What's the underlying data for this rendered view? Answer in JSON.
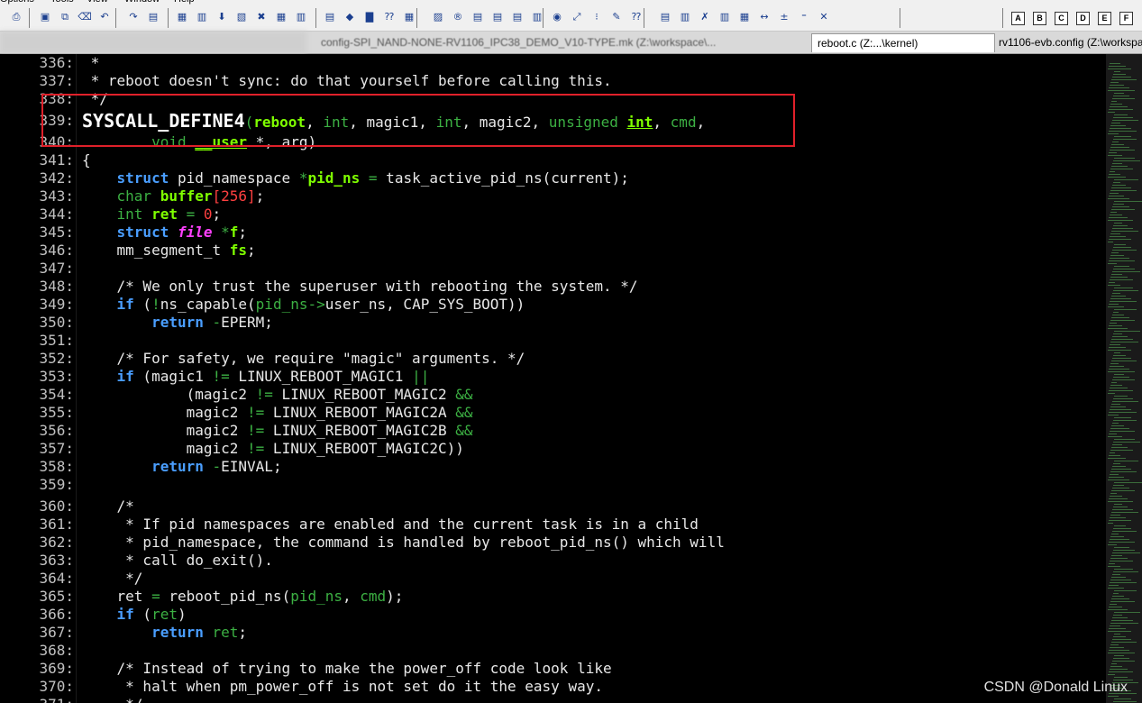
{
  "menu": [
    "Options",
    "Tools",
    "View",
    "Window",
    "Help"
  ],
  "toolbar_letters": [
    "A",
    "B",
    "C",
    "D",
    "E",
    "F"
  ],
  "tabs": [
    {
      "label": "config-SPI_NAND-NONE-RV1106_IPC38_DEMO_V10-TYPE.mk (Z:\\workspace\\...",
      "active": false
    },
    {
      "label": "reboot.c (Z:...\\kernel)",
      "active": true
    },
    {
      "label": "rv1106-evb.config (Z:\\workspa",
      "active": false
    }
  ],
  "editor": {
    "lines": [
      {
        "n": "336:",
        "t": [
          [
            "cm",
            " *"
          ]
        ]
      },
      {
        "n": "337:",
        "t": [
          [
            "cm",
            " * reboot doesn't sync: do that yourself before calling this."
          ]
        ]
      },
      {
        "n": "338:",
        "t": [
          [
            "cm",
            " */"
          ]
        ]
      },
      {
        "n": "339:",
        "t": [
          [
            "mac",
            "SYSCALL_DEFINE4"
          ],
          [
            "par",
            "("
          ],
          [
            "id",
            "reboot"
          ],
          [
            "str",
            ", "
          ],
          [
            "ty",
            "int"
          ],
          [
            "str",
            ", magic1, "
          ],
          [
            "ty",
            "int"
          ],
          [
            "str",
            ", magic2, "
          ],
          [
            "ty",
            "unsigned "
          ],
          [
            "id",
            "int"
          ],
          [
            "str",
            ", "
          ],
          [
            "grn",
            "cmd"
          ],
          [
            "str",
            ","
          ]
        ]
      },
      {
        "n": "340:",
        "t": [
          [
            "str",
            "        "
          ],
          [
            "ty",
            "void "
          ],
          [
            "id",
            "__user"
          ],
          [
            "str",
            " *, arg)"
          ]
        ]
      },
      {
        "n": "341:",
        "t": [
          [
            "str",
            "{"
          ]
        ]
      },
      {
        "n": "342:",
        "t": [
          [
            "str",
            "    "
          ],
          [
            "kw",
            "struct"
          ],
          [
            "str",
            " pid_namespace "
          ],
          [
            "op",
            "*"
          ],
          [
            "id",
            "pid_ns"
          ],
          [
            "str",
            " "
          ],
          [
            "op",
            "="
          ],
          [
            "str",
            " task_active_pid_ns(current);"
          ]
        ]
      },
      {
        "n": "343:",
        "t": [
          [
            "str",
            "    "
          ],
          [
            "ty",
            "char "
          ],
          [
            "id",
            "buffer"
          ],
          [
            "num",
            "[256]"
          ],
          [
            "str",
            ";"
          ]
        ]
      },
      {
        "n": "344:",
        "t": [
          [
            "str",
            "    "
          ],
          [
            "ty",
            "int "
          ],
          [
            "id",
            "ret"
          ],
          [
            "str",
            " "
          ],
          [
            "op",
            "="
          ],
          [
            "num",
            " 0"
          ],
          [
            "str",
            ";"
          ]
        ]
      },
      {
        "n": "345:",
        "t": [
          [
            "str",
            "    "
          ],
          [
            "kw",
            "struct "
          ],
          [
            "ital",
            "file"
          ],
          [
            "str",
            " "
          ],
          [
            "op",
            "*"
          ],
          [
            "id",
            "f"
          ],
          [
            "str",
            ";"
          ]
        ]
      },
      {
        "n": "346:",
        "t": [
          [
            "str",
            "    mm_segment_t "
          ],
          [
            "id",
            "fs"
          ],
          [
            "str",
            ";"
          ]
        ]
      },
      {
        "n": "347:",
        "t": [
          [
            "str",
            ""
          ]
        ]
      },
      {
        "n": "348:",
        "t": [
          [
            "str",
            "    /* We only trust the superuser with rebooting the system. */"
          ]
        ]
      },
      {
        "n": "349:",
        "t": [
          [
            "str",
            "    "
          ],
          [
            "kw",
            "if"
          ],
          [
            "str",
            " ("
          ],
          [
            "op",
            "!"
          ],
          [
            "str",
            "ns_capable("
          ],
          [
            "grn",
            "pid_ns"
          ],
          [
            "op",
            "->"
          ],
          [
            "str",
            "user_ns, CAP_SYS_BOOT))"
          ]
        ]
      },
      {
        "n": "350:",
        "t": [
          [
            "str",
            "        "
          ],
          [
            "kw",
            "return"
          ],
          [
            "str",
            " "
          ],
          [
            "op",
            "-"
          ],
          [
            "str",
            "EPERM;"
          ]
        ]
      },
      {
        "n": "351:",
        "t": [
          [
            "str",
            ""
          ]
        ]
      },
      {
        "n": "352:",
        "t": [
          [
            "str",
            "    /* For safety, we require \"magic\" arguments. */"
          ]
        ]
      },
      {
        "n": "353:",
        "t": [
          [
            "str",
            "    "
          ],
          [
            "kw",
            "if"
          ],
          [
            "str",
            " (magic1 "
          ],
          [
            "op",
            "!="
          ],
          [
            "str",
            " LINUX_REBOOT_MAGIC1 "
          ],
          [
            "op",
            "||"
          ]
        ]
      },
      {
        "n": "354:",
        "t": [
          [
            "str",
            "            (magic2 "
          ],
          [
            "op",
            "!="
          ],
          [
            "str",
            " LINUX_REBOOT_MAGIC2 "
          ],
          [
            "op",
            "&&"
          ]
        ]
      },
      {
        "n": "355:",
        "t": [
          [
            "str",
            "            magic2 "
          ],
          [
            "op",
            "!="
          ],
          [
            "str",
            " LINUX_REBOOT_MAGIC2A "
          ],
          [
            "op",
            "&&"
          ]
        ]
      },
      {
        "n": "356:",
        "t": [
          [
            "str",
            "            magic2 "
          ],
          [
            "op",
            "!="
          ],
          [
            "str",
            " LINUX_REBOOT_MAGIC2B "
          ],
          [
            "op",
            "&&"
          ]
        ]
      },
      {
        "n": "357:",
        "t": [
          [
            "str",
            "            magic2 "
          ],
          [
            "op",
            "!="
          ],
          [
            "str",
            " LINUX_REBOOT_MAGIC2C))"
          ]
        ]
      },
      {
        "n": "358:",
        "t": [
          [
            "str",
            "        "
          ],
          [
            "kw",
            "return"
          ],
          [
            "str",
            " "
          ],
          [
            "op",
            "-"
          ],
          [
            "str",
            "EINVAL;"
          ]
        ]
      },
      {
        "n": "359:",
        "t": [
          [
            "str",
            ""
          ]
        ]
      },
      {
        "n": "360:",
        "t": [
          [
            "str",
            "    /*"
          ]
        ]
      },
      {
        "n": "361:",
        "t": [
          [
            "str",
            "     * If pid namespaces are enabled and the current task is in a child"
          ]
        ]
      },
      {
        "n": "362:",
        "t": [
          [
            "str",
            "     * pid_namespace, the command is handled by reboot_pid_ns() which will"
          ]
        ]
      },
      {
        "n": "363:",
        "t": [
          [
            "str",
            "     * call do_exit()."
          ]
        ]
      },
      {
        "n": "364:",
        "t": [
          [
            "str",
            "     */"
          ]
        ]
      },
      {
        "n": "365:",
        "t": [
          [
            "str",
            "    ret "
          ],
          [
            "op",
            "="
          ],
          [
            "str",
            " reboot_pid_ns("
          ],
          [
            "grn",
            "pid_ns"
          ],
          [
            "str",
            ", "
          ],
          [
            "grn",
            "cmd"
          ],
          [
            "str",
            ");"
          ]
        ]
      },
      {
        "n": "366:",
        "t": [
          [
            "str",
            "    "
          ],
          [
            "kw",
            "if"
          ],
          [
            "str",
            " ("
          ],
          [
            "grn",
            "ret"
          ],
          [
            "str",
            ")"
          ]
        ]
      },
      {
        "n": "367:",
        "t": [
          [
            "str",
            "        "
          ],
          [
            "kw",
            "return"
          ],
          [
            "str",
            " "
          ],
          [
            "grn",
            "ret"
          ],
          [
            "str",
            ";"
          ]
        ]
      },
      {
        "n": "368:",
        "t": [
          [
            "str",
            ""
          ]
        ]
      },
      {
        "n": "369:",
        "t": [
          [
            "str",
            "    /* Instead of trying to make the power_off code look like"
          ]
        ]
      },
      {
        "n": "370:",
        "t": [
          [
            "str",
            "     * halt when pm_power_off is not set do it the easy way."
          ]
        ]
      },
      {
        "n": "371:",
        "t": [
          [
            "str",
            "     */"
          ]
        ]
      }
    ]
  },
  "watermark": "CSDN @Donald Linux"
}
